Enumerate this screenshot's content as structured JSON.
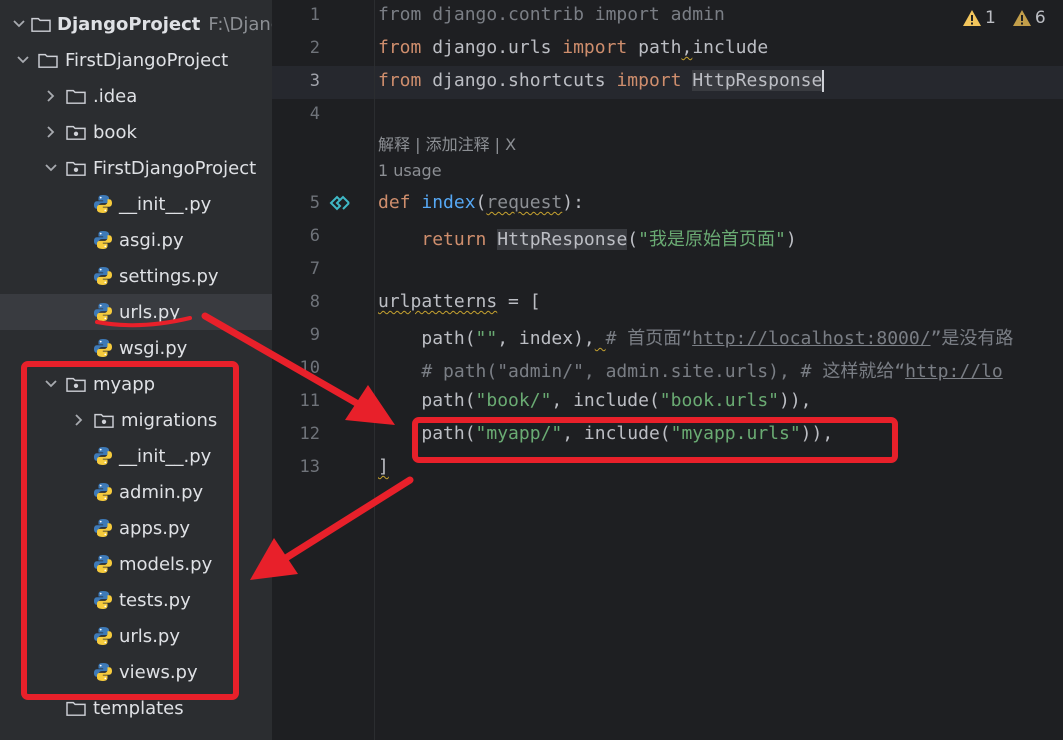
{
  "tree": {
    "root": {
      "name": "DjangoProject",
      "path": "F:\\DjangoP"
    },
    "rows": [
      {
        "label": "FirstDjangoProject",
        "indent": 0,
        "chevron": "down",
        "icon": "folder-icon"
      },
      {
        "label": ".idea",
        "indent": 1,
        "chevron": "right",
        "icon": "folder-icon"
      },
      {
        "label": "book",
        "indent": 1,
        "chevron": "right",
        "icon": "package-folder-icon"
      },
      {
        "label": "FirstDjangoProject",
        "indent": 1,
        "chevron": "down",
        "icon": "package-folder-icon"
      },
      {
        "label": "__init__.py",
        "indent": 2,
        "chevron": "none",
        "icon": "python-file-icon"
      },
      {
        "label": "asgi.py",
        "indent": 2,
        "chevron": "none",
        "icon": "python-file-icon"
      },
      {
        "label": "settings.py",
        "indent": 2,
        "chevron": "none",
        "icon": "python-file-icon"
      },
      {
        "label": "urls.py",
        "indent": 2,
        "chevron": "none",
        "icon": "python-file-icon",
        "selected": true
      },
      {
        "label": "wsgi.py",
        "indent": 2,
        "chevron": "none",
        "icon": "python-file-icon"
      },
      {
        "label": "myapp",
        "indent": 1,
        "chevron": "down",
        "icon": "package-folder-icon"
      },
      {
        "label": "migrations",
        "indent": 2,
        "chevron": "right",
        "icon": "package-folder-icon"
      },
      {
        "label": "__init__.py",
        "indent": 2,
        "chevron": "none",
        "icon": "python-file-icon"
      },
      {
        "label": "admin.py",
        "indent": 2,
        "chevron": "none",
        "icon": "python-file-icon"
      },
      {
        "label": "apps.py",
        "indent": 2,
        "chevron": "none",
        "icon": "python-file-icon"
      },
      {
        "label": "models.py",
        "indent": 2,
        "chevron": "none",
        "icon": "python-file-icon"
      },
      {
        "label": "tests.py",
        "indent": 2,
        "chevron": "none",
        "icon": "python-file-icon"
      },
      {
        "label": "urls.py",
        "indent": 2,
        "chevron": "none",
        "icon": "python-file-icon"
      },
      {
        "label": "views.py",
        "indent": 2,
        "chevron": "none",
        "icon": "python-file-icon"
      },
      {
        "label": "templates",
        "indent": 1,
        "chevron": "none",
        "icon": "folder-icon"
      }
    ]
  },
  "editor": {
    "warnings": {
      "weak": "1",
      "warn": "6"
    },
    "current_line": "3",
    "line_numbers": [
      "1",
      "2",
      "3",
      "4",
      "5",
      "6",
      "7",
      "8",
      "9",
      "10",
      "11",
      "12",
      "13"
    ],
    "hints": {
      "ai_actions": "解释 | 添加注释 | X",
      "usages": "1 usage"
    },
    "code": {
      "l1": {
        "kw1": "from",
        "mod": " django.contrib ",
        "kw2": "import",
        "name": " admin"
      },
      "l2": {
        "kw1": "from",
        "mod": " django.urls ",
        "kw2": "import",
        "a": " path",
        "b": ",",
        "c": "include"
      },
      "l3": {
        "kw1": "from",
        "mod": " django.shortcuts ",
        "kw2": "import",
        "sp": " ",
        "name": "HttpResponse"
      },
      "l5": {
        "kw": "def",
        "sp": " ",
        "fn": "index",
        "p1": "(",
        "param": "request",
        "p2": "):"
      },
      "l6": {
        "indent": "    ",
        "kw": "return",
        "sp": " ",
        "cls": "HttpResponse",
        "p1": "(",
        "str": "\"我是原始首页面\"",
        "p2": ")"
      },
      "l8": {
        "var": "urlpatterns",
        "rest": " = ["
      },
      "l9": {
        "indent": "    ",
        "a": "path(",
        "s": "\"\"",
        "b": ", index),",
        "sp": " ",
        "c1": "# 首页面“",
        "url": "http://localhost:8000/",
        "c2": "”是没有路"
      },
      "l10": {
        "indent": "    ",
        "c1": "# path(\"admin/\", admin.site.urls), # 这样就给“",
        "url": "http://lo"
      },
      "l11": {
        "indent": "    ",
        "a": "path(",
        "s1": "\"book/\"",
        "b": ", include(",
        "s2": "\"book.urls\"",
        "c": ")),"
      },
      "l12": {
        "indent": "    ",
        "a": "path(",
        "s1": "\"myapp/\"",
        "b": ", include(",
        "s2": "\"myapp.urls\"",
        "c": ")),"
      },
      "l13": {
        "a": "]"
      }
    }
  },
  "colors": {
    "annotation": "#e8202a",
    "keyword": "#cf8e6d",
    "function": "#56a8f5",
    "string": "#6aab73",
    "comment": "#7a7e85"
  }
}
